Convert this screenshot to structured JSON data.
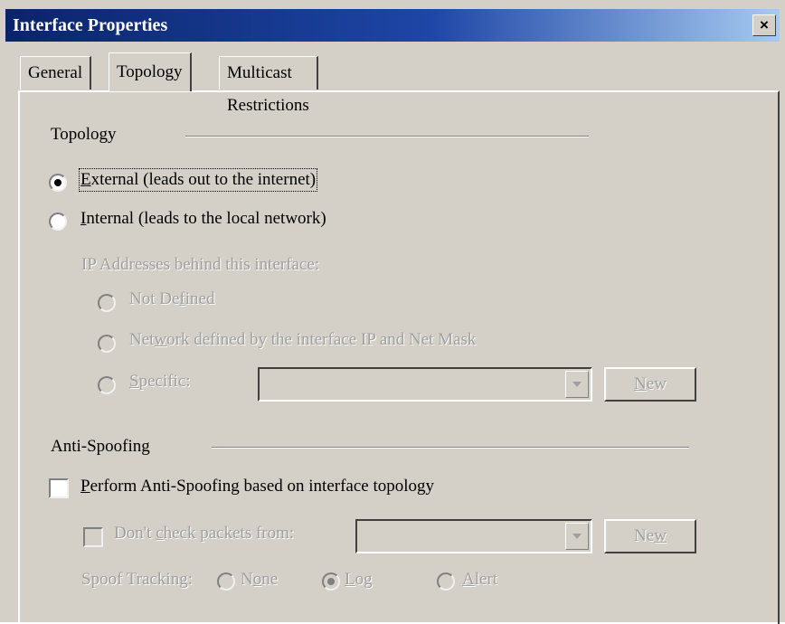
{
  "window": {
    "title": "Interface Properties",
    "close_label": "×"
  },
  "tabs": [
    {
      "label": "General",
      "active": false
    },
    {
      "label": "Topology",
      "active": true
    },
    {
      "label": "Multicast Restrictions",
      "active": false
    }
  ],
  "topology": {
    "group_label": "Topology",
    "external": {
      "label_mn": "E",
      "label_rest": "xternal (leads out to the internet)",
      "selected": true
    },
    "internal": {
      "label_mn": "I",
      "label_rest": "nternal (leads to the local network)",
      "selected": false
    },
    "ip_label": "IP Addresses behind this interface:",
    "not_defined": {
      "label_pre": "Not De",
      "label_mn": "f",
      "label_post": "ined"
    },
    "network_defined": {
      "label_pre": "Net",
      "label_mn": "w",
      "label_post": "ork defined by the interface IP and Net Mask"
    },
    "specific": {
      "label_mn": "S",
      "label_post": "pecific:"
    },
    "new_button": {
      "label_mn": "N",
      "label_post": "ew"
    }
  },
  "anti_spoofing": {
    "group_label": "Anti-Spoofing",
    "perform": {
      "label_mn": "P",
      "label_post": "erform Anti-Spoofing based on interface topology",
      "checked": false
    },
    "dont_check": {
      "label_pre": "Don't ",
      "label_mn": "c",
      "label_post": "heck packets from:",
      "checked": false
    },
    "new_button": {
      "label_pre": "Ne",
      "label_mn": "w"
    },
    "spoof_tracking_label": "Spoof Tracking:",
    "none": {
      "label_pre": "N",
      "label_mn": "o",
      "label_post": "ne"
    },
    "log": {
      "label_mn": "L",
      "label_post": "og",
      "selected": true
    },
    "alert": {
      "label_mn": "A",
      "label_post": "lert"
    }
  }
}
